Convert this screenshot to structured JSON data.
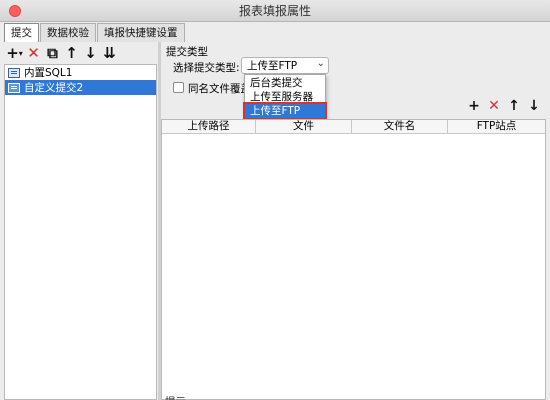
{
  "window": {
    "title": "报表填报属性"
  },
  "tabs": [
    {
      "label": "提交",
      "active": true
    },
    {
      "label": "数据校验",
      "active": false
    },
    {
      "label": "填报快捷键设置",
      "active": false
    }
  ],
  "left_toolbar": {
    "icons": [
      "add-icon",
      "delete-icon",
      "copy-icon",
      "move-up-icon",
      "move-down-icon",
      "sort-icon"
    ],
    "add_glyph": "+",
    "add_caret": "▾",
    "delete_glyph": "✕",
    "copy_glyph": "⧉",
    "up_glyph": "↑",
    "down_glyph": "↓",
    "sort_glyph": "⇊"
  },
  "tree": {
    "items": [
      {
        "label": "内置SQL1",
        "selected": false
      },
      {
        "label": "自定义提交2",
        "selected": true
      }
    ]
  },
  "submit_panel": {
    "section_label": "提交类型",
    "type_label": "选择提交类型:",
    "type_value": "上传至FTP",
    "chevron": "⌄",
    "overwrite_label": "同名文件覆盖",
    "overwrite_checked": false,
    "options": [
      "后台类提交",
      "上传至服务器",
      "上传至FTP"
    ],
    "highlighted_option": "上传至FTP"
  },
  "table_toolbar": {
    "add_glyph": "+",
    "delete_glyph": "✕",
    "up_glyph": "↑",
    "down_glyph": "↓"
  },
  "table": {
    "columns": [
      "上传路径",
      "文件",
      "文件名",
      "FTP站点"
    ],
    "rows": []
  },
  "footer": {
    "label": "提示"
  },
  "colors": {
    "selection": "#2f78d8",
    "highlight_border": "#d6342f",
    "delete_red": "#d23131"
  }
}
